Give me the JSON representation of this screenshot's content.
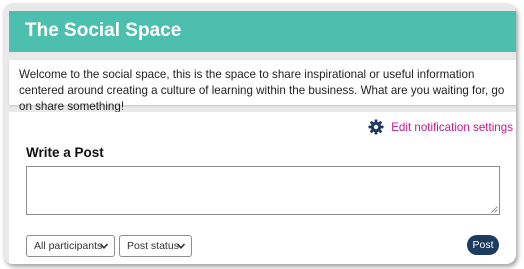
{
  "header": {
    "title": "The Social Space"
  },
  "intro": {
    "text": "Welcome to the social space, this is the space to share inspirational or useful information centered around creating a culture of learning within the business. What are you waiting for, go on share something!"
  },
  "composer": {
    "notification_link_label": "Edit notification settings",
    "notification_icon": "gear-icon",
    "section_title": "Write a Post",
    "post_text_value": "",
    "participants_select_value": "All participants",
    "status_select_value": "Post status",
    "post_button_label": "Post"
  },
  "colors": {
    "banner": "#4dbfae",
    "link": "#c2178c",
    "post_button": "#1d3a5f",
    "frame": "#e9e9e9"
  }
}
